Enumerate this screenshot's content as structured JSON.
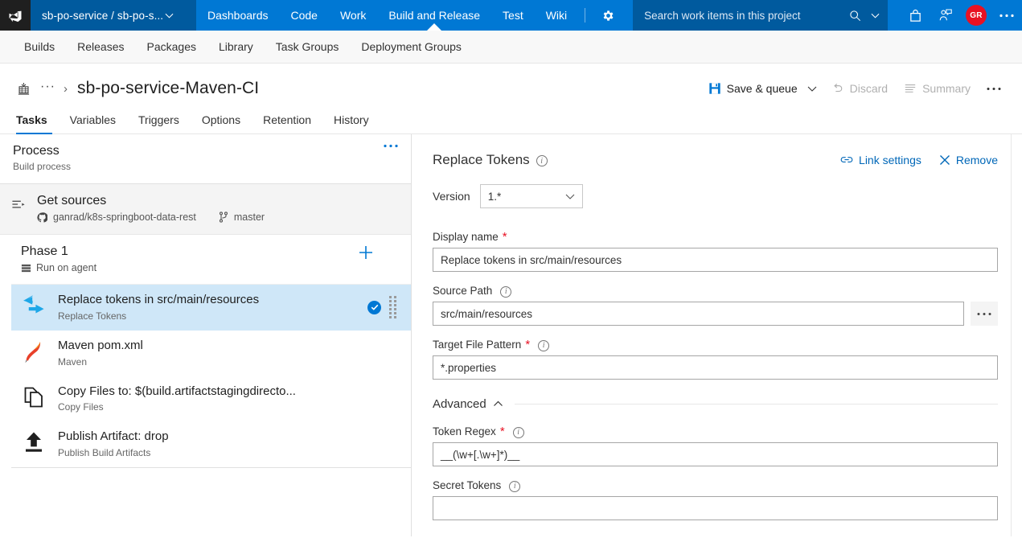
{
  "topnav": {
    "logo_icon": "azure-devops-logo",
    "project": "sb-po-service / sb-po-s...",
    "project_chevron": "chevron-down-icon",
    "items": [
      {
        "label": "Dashboards",
        "active": false
      },
      {
        "label": "Code",
        "active": false
      },
      {
        "label": "Work",
        "active": false
      },
      {
        "label": "Build and Release",
        "active": true
      },
      {
        "label": "Test",
        "active": false
      },
      {
        "label": "Wiki",
        "active": false
      }
    ],
    "gear_icon": "gear-icon",
    "search": {
      "placeholder": "Search work items in this project",
      "search_icon": "search-icon",
      "chevron_icon": "chevron-down-icon"
    },
    "marketplace_icon": "marketplace-bag-icon",
    "feedback_icon": "feedback-person-icon",
    "avatar_initials": "GR",
    "more_icon": "ellipsis-icon",
    "bg_color": "#0078d4",
    "accent_dark": "#005a9e",
    "avatar_color": "#e81123"
  },
  "subnav": {
    "items": [
      "Builds",
      "Releases",
      "Packages",
      "Library",
      "Task Groups",
      "Deployment Groups"
    ]
  },
  "pagehead": {
    "breadcrumb_icon": "build-definition-icon",
    "breadcrumb_dots": "···",
    "breadcrumb_chevron": "›",
    "title": "sb-po-service-Maven-CI",
    "toolbar": {
      "save_queue_label": "Save & queue",
      "save_icon": "save-disk-icon",
      "save_chevron": "chevron-down-icon",
      "discard_label": "Discard",
      "discard_icon": "undo-icon",
      "discard_disabled": true,
      "summary_label": "Summary",
      "summary_icon": "list-icon",
      "summary_disabled": true,
      "more_icon": "ellipsis-icon"
    }
  },
  "tabs": [
    {
      "label": "Tasks",
      "active": true
    },
    {
      "label": "Variables",
      "active": false
    },
    {
      "label": "Triggers",
      "active": false
    },
    {
      "label": "Options",
      "active": false
    },
    {
      "label": "Retention",
      "active": false
    },
    {
      "label": "History",
      "active": false
    }
  ],
  "sidebar": {
    "process": {
      "title": "Process",
      "subtitle": "Build process",
      "more_icon": "ellipsis-icon"
    },
    "get_sources": {
      "icon": "get-sources-icon",
      "title": "Get sources",
      "repo_icon": "github-icon",
      "repo": "ganrad/k8s-springboot-data-rest",
      "branch_icon": "branch-icon",
      "branch": "master"
    },
    "phase": {
      "title": "Phase 1",
      "agent_icon": "agent-server-icon",
      "subtitle": "Run on agent",
      "add_icon": "plus-icon"
    },
    "tasks": [
      {
        "icon": "replace-tokens-arrows-icon",
        "title": "Replace tokens in src/main/resources",
        "subtitle": "Replace Tokens",
        "selected": true,
        "enabled_icon": "check-circle-icon",
        "drag_icon": "drag-grip-icon"
      },
      {
        "icon": "maven-feather-icon",
        "title": "Maven pom.xml",
        "subtitle": "Maven",
        "selected": false
      },
      {
        "icon": "copy-files-icon",
        "title": "Copy Files to: $(build.artifactstagingdirecto...",
        "subtitle": "Copy Files",
        "selected": false
      },
      {
        "icon": "publish-artifact-upload-icon",
        "title": "Publish Artifact: drop",
        "subtitle": "Publish Build Artifacts",
        "selected": false
      }
    ],
    "selected_bg": "#cfe7f8"
  },
  "panel": {
    "title": "Replace Tokens",
    "title_info_icon": "info-icon",
    "link_settings": {
      "label": "Link settings",
      "icon": "link-icon"
    },
    "remove": {
      "label": "Remove",
      "icon": "close-x-icon"
    },
    "version": {
      "label": "Version",
      "value": "1.*",
      "chevron_icon": "chevron-down-icon"
    },
    "fields": [
      {
        "label": "Display name",
        "required": true,
        "info": false,
        "value": "Replace tokens in src/main/resources",
        "browse": false
      },
      {
        "label": "Source Path",
        "required": false,
        "info": true,
        "value": "src/main/resources",
        "browse": true,
        "browse_label": "···"
      },
      {
        "label": "Target File Pattern",
        "required": true,
        "info": true,
        "value": "*.properties",
        "browse": false
      }
    ],
    "advanced": {
      "label": "Advanced",
      "chevron_icon": "chevron-up-icon",
      "fields": [
        {
          "label": "Token Regex",
          "required": true,
          "info": true,
          "value": "__(\\w+[.\\w+]*)__",
          "browse": false
        },
        {
          "label": "Secret Tokens",
          "required": false,
          "info": true,
          "value": "",
          "browse": false
        }
      ]
    },
    "link_color": "#0067b8"
  }
}
